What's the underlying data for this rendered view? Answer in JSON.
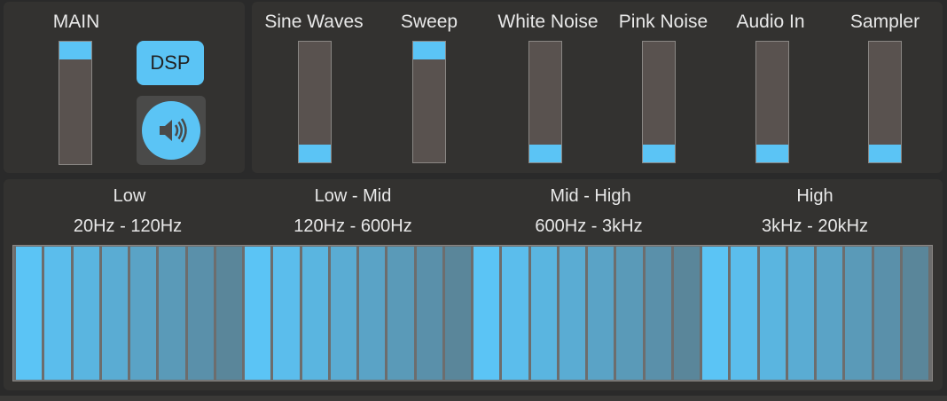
{
  "main": {
    "title": "MAIN",
    "level": 1.0,
    "dsp_label": "DSP",
    "speaker_icon": "speaker-icon"
  },
  "sources": [
    {
      "label": "Sine Waves",
      "level": 0.0
    },
    {
      "label": "Sweep",
      "level": 1.0
    },
    {
      "label": "White Noise",
      "level": 0.0
    },
    {
      "label": "Pink Noise",
      "level": 0.0
    },
    {
      "label": "Audio In",
      "level": 0.0
    },
    {
      "label": "Sampler",
      "level": 0.0
    }
  ],
  "bands": [
    {
      "name": "Low",
      "range": "20Hz - 120Hz"
    },
    {
      "name": "Low - Mid",
      "range": "120Hz - 600Hz"
    },
    {
      "name": "Mid - High",
      "range": "600Hz - 3kHz"
    },
    {
      "name": "High",
      "range": "3kHz - 20kHz"
    }
  ],
  "colors": {
    "accent": "#5bc4f5",
    "bar_shades": [
      "#5bc4f5",
      "#5bbdec",
      "#5ab5e0",
      "#5aacd3",
      "#5aa3c6",
      "#5a9ab8",
      "#5a90aa",
      "#5a869a"
    ]
  }
}
